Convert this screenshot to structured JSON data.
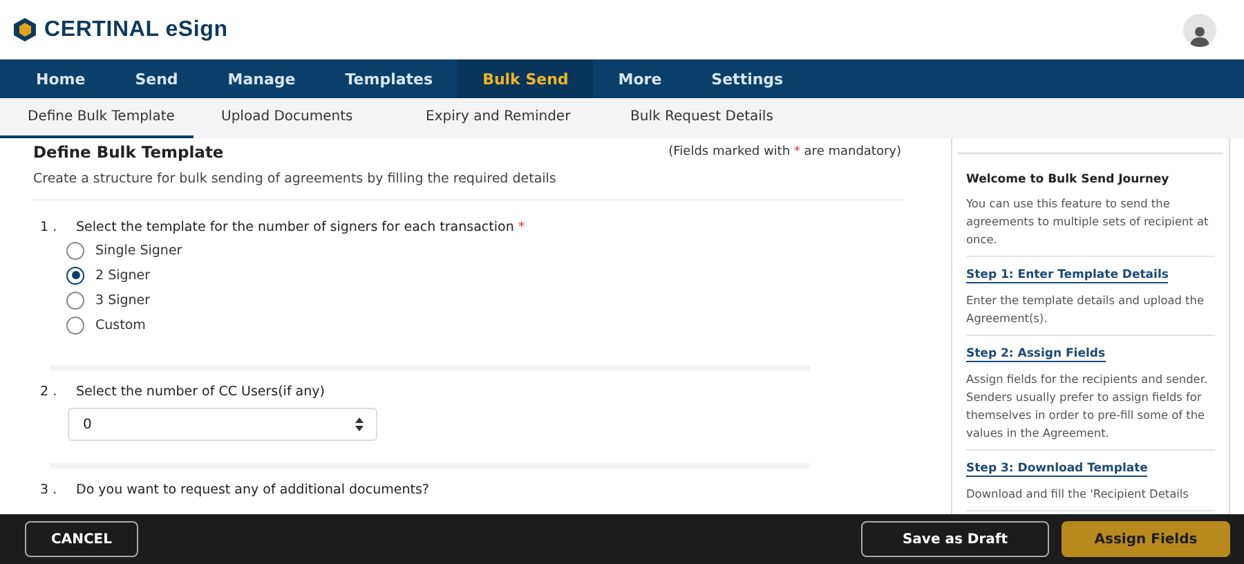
{
  "brand": {
    "name": "CERTINAL eSign"
  },
  "nav": [
    {
      "label": "Home",
      "selected": false
    },
    {
      "label": "Send",
      "selected": false
    },
    {
      "label": "Manage",
      "selected": false
    },
    {
      "label": "Templates",
      "selected": false
    },
    {
      "label": "Bulk Send",
      "selected": true
    },
    {
      "label": "More",
      "selected": false
    },
    {
      "label": "Settings",
      "selected": false
    }
  ],
  "steps": [
    {
      "label": "Define Bulk Template",
      "selected": true
    },
    {
      "label": "Upload Documents",
      "selected": false
    },
    {
      "label": "Expiry and Reminder",
      "selected": false
    },
    {
      "label": "Bulk Request Details",
      "selected": false
    }
  ],
  "form": {
    "title": "Define Bulk Template",
    "note": {
      "before": "(Fields marked with",
      "mark": "*",
      "after": "are mandatory)"
    },
    "subtitle": "Create a structure for bulk sending of agreements by filling the required details",
    "questions": [
      {
        "kind": "radio",
        "number": "1 .",
        "text": "Select the template for the number of signers for each transaction",
        "required": true,
        "options": [
          {
            "label": "Single Signer",
            "selected": false
          },
          {
            "label": "2 Signer",
            "selected": true
          },
          {
            "label": "3 Signer",
            "selected": false
          },
          {
            "label": "Custom",
            "selected": false
          }
        ]
      },
      {
        "kind": "number",
        "number": "2 .",
        "text": "Select the number of CC Users(if any)",
        "required": false,
        "value": "0"
      },
      {
        "kind": "plain",
        "number": "3 .",
        "text": "Do you want to request any of additional documents?",
        "required": false
      }
    ]
  },
  "help": {
    "title": "Welcome to Bulk Send Journey",
    "intro": "You can use this feature to send the agreements to multiple sets of recipient at once.",
    "steps": [
      {
        "title": "Step 1: Enter Template Details",
        "text": "Enter the template details and upload the Agreement(s)."
      },
      {
        "title": "Step 2: Assign Fields",
        "text": "Assign fields for the recipients and sender. Senders usually prefer to assign fields for themselves in order to pre-fill some of the values in the Agreement."
      },
      {
        "title": "Step 3: Download Template",
        "text": "Download and fill the 'Recipient Details"
      }
    ]
  },
  "footer": {
    "cancel": "CANCEL",
    "draft": "Save as Draft",
    "primary": "Assign Fields"
  }
}
